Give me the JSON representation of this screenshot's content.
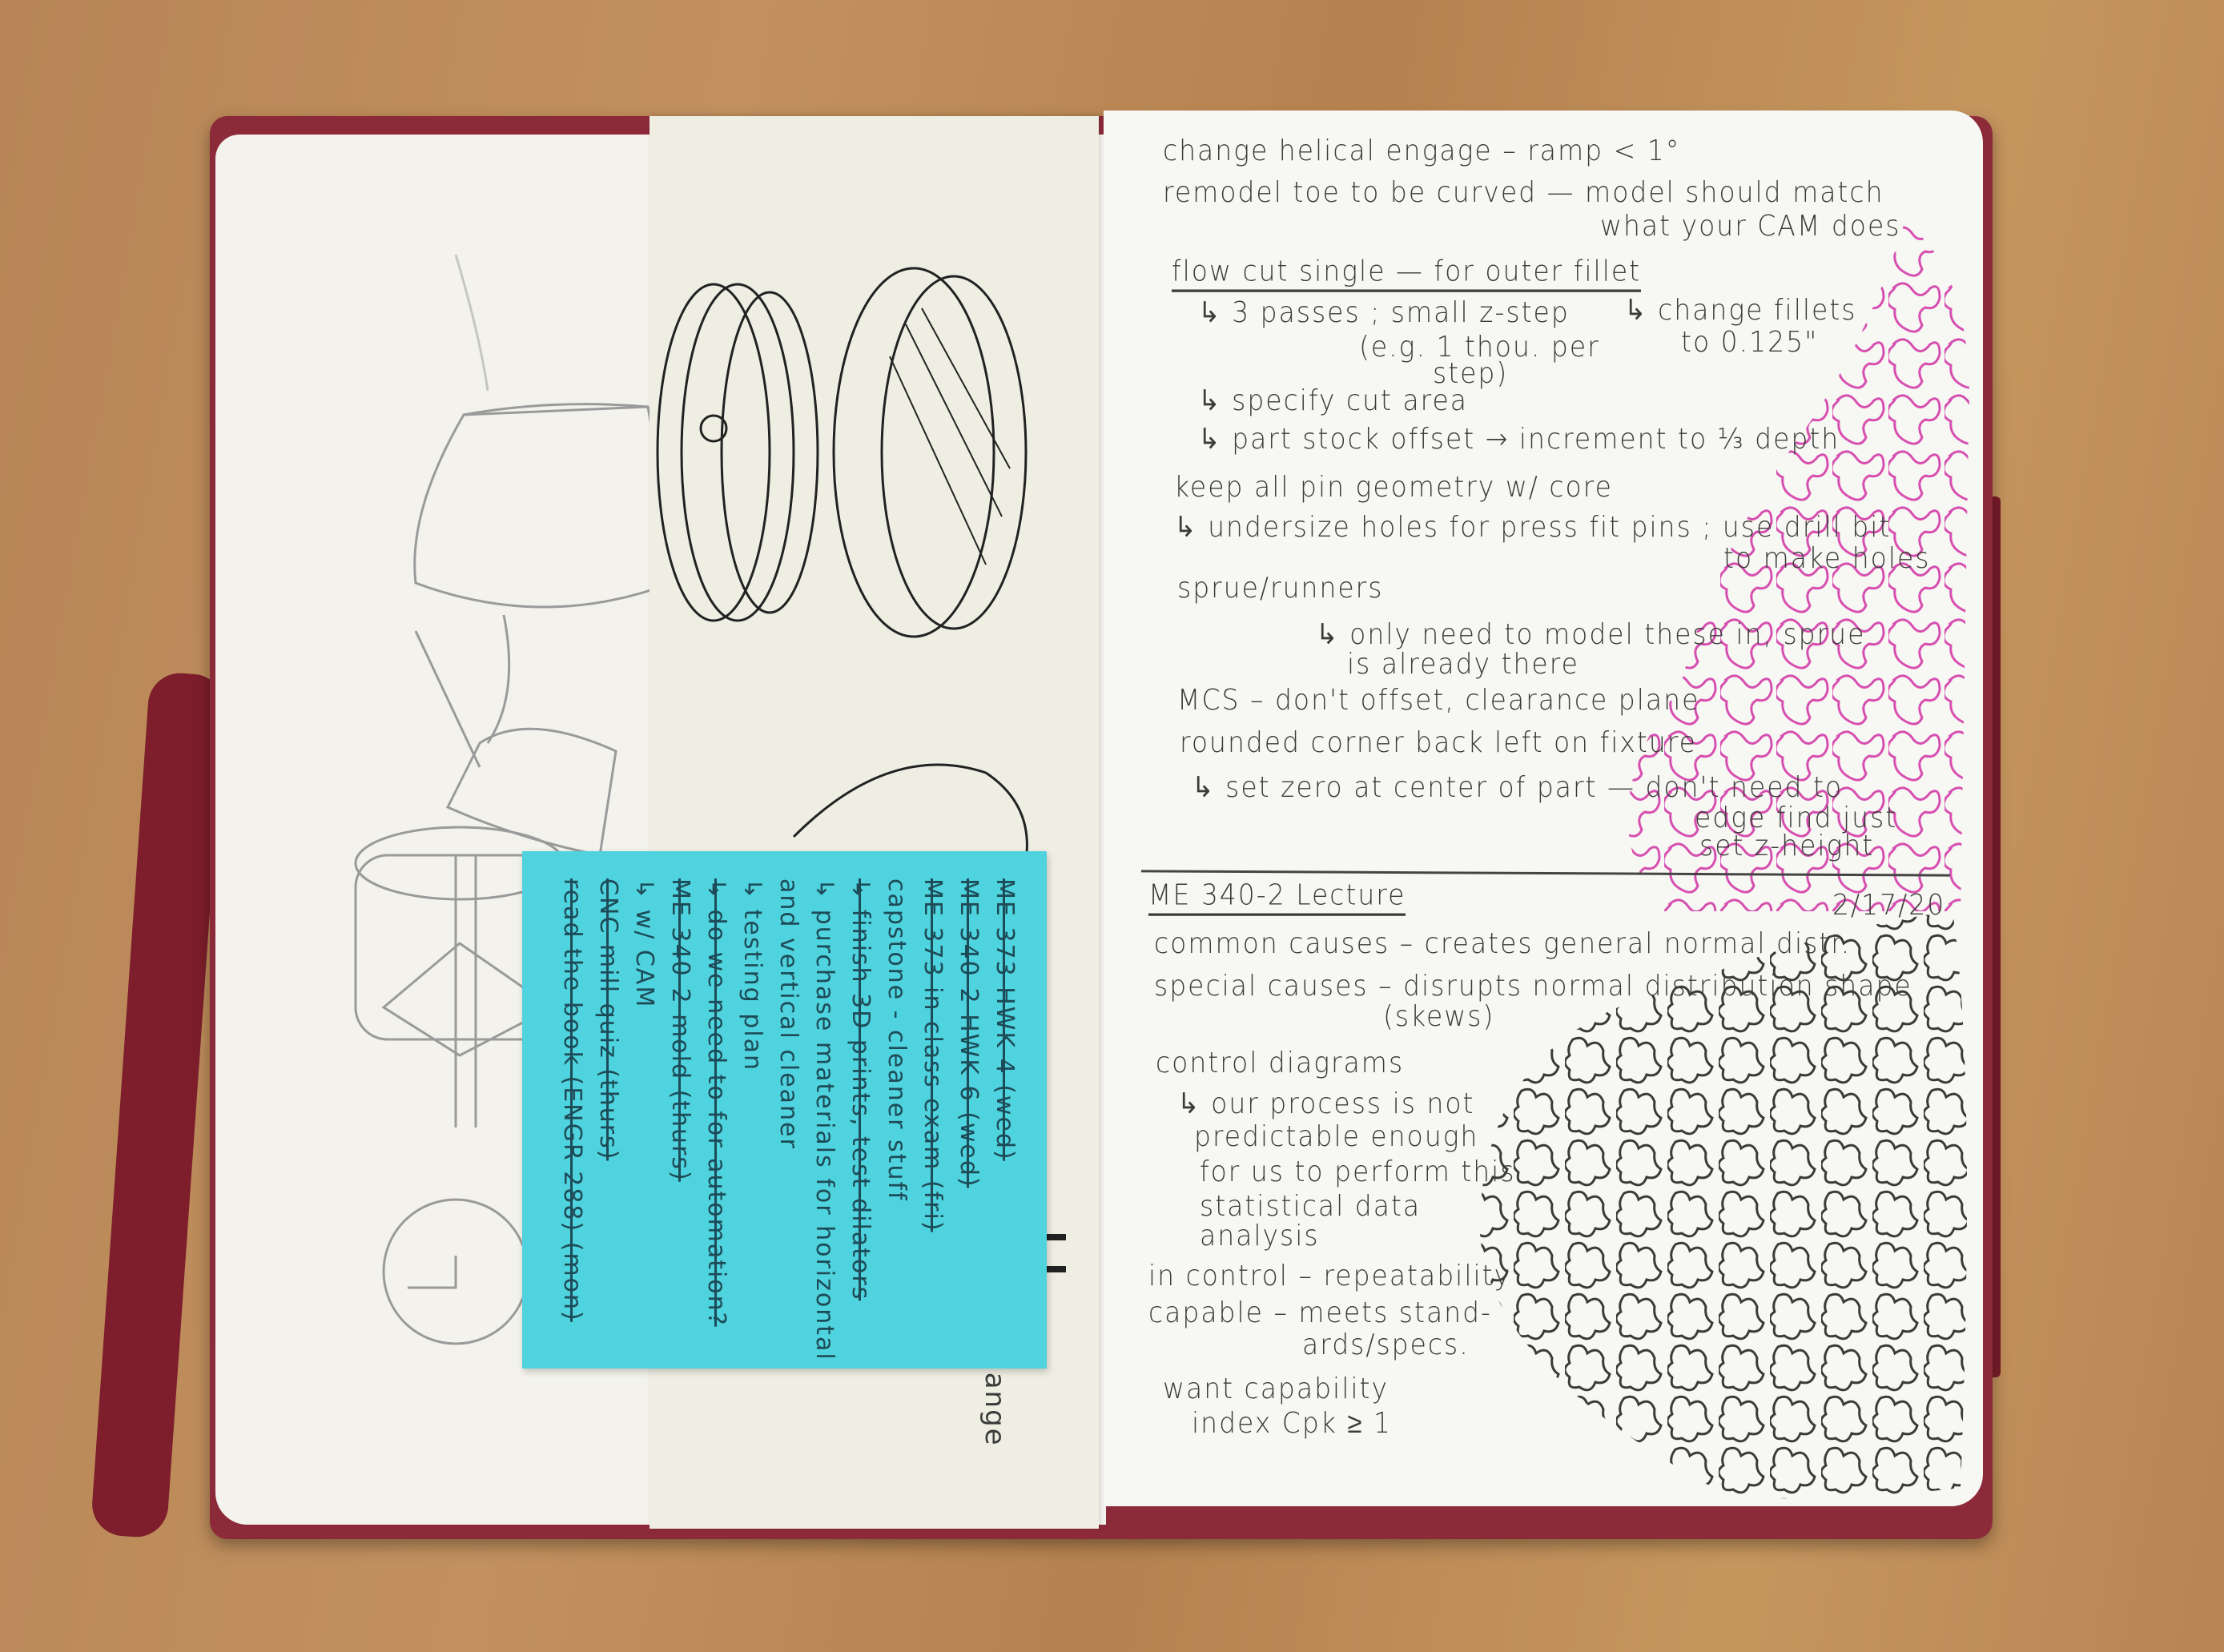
{
  "colors": {
    "cover": "#8c2a3a",
    "sticky": "#4fd3de",
    "pink_ink": "#d64fb0",
    "black_ink": "#3b3b3b"
  },
  "right_page": {
    "notes": [
      "change helical engage – ramp < 1°",
      "remodel toe to be curved — model should match",
      "what your CAM does",
      "flow cut single — for outer fillet",
      "↳ 3 passes ; small z-step",
      "(e.g. 1 thou. per",
      "step)",
      "↳ change fillets",
      "to 0.125\"",
      "↳ specify cut area",
      "↳ part stock offset → increment to ⅓ depth",
      "keep all pin geometry w/ core",
      "↳ undersize holes for press fit pins ; use drill bit",
      "to make holes",
      "sprue/runners",
      "↳ only need to model these in, sprue",
      "is already there",
      "MCS – don't offset, clearance plane",
      "rounded corner back left on fixture",
      "↳ set zero at center of part — don't need to",
      "edge find just",
      "set z-height"
    ],
    "lecture": {
      "title": "ME 340-2 Lecture",
      "date": "2/17/20",
      "lines": [
        "common causes – creates general normal distr.",
        "special causes – disrupts normal distribution shape",
        "(skews)",
        "control diagrams",
        "↳ our process is not",
        "predictable enough",
        "for us to perform this",
        "statistical data",
        "analysis",
        "in control – repeatability",
        "capable – meets stand-",
        "ards/specs.",
        "want capability",
        "index Cpk ≥ 1"
      ]
    }
  },
  "insert": {
    "flange_label": "← flange"
  },
  "sticky_note": {
    "lines": [
      {
        "text": "ME 373 HWK 4 (wed)",
        "struck": true
      },
      {
        "text": "ME 340-2 HWK 6 (wed)",
        "struck": true
      },
      {
        "text": "ME 373 in class exam (fri)",
        "struck": true
      },
      {
        "text": "capstone - cleaner stuff",
        "struck": false
      },
      {
        "text": " ↳ finish 3D prints, test dilators",
        "struck": true
      },
      {
        "text": "  ↳ purchase materials for horizontal",
        "struck": false
      },
      {
        "text": "     and vertical cleaner",
        "struck": false
      },
      {
        "text": " ↳ testing plan",
        "struck": false
      },
      {
        "text": "  ↳ do we need to for automation?",
        "struck": true
      },
      {
        "text": "ME 340-2 mold (thurs)",
        "struck": true
      },
      {
        "text": "          ↳ w/ CAM",
        "struck": false
      },
      {
        "text": "CNC mill quiz (thurs)",
        "struck": true
      },
      {
        "text": "read the book (ENGR 288) (mon)",
        "struck": true
      }
    ]
  }
}
